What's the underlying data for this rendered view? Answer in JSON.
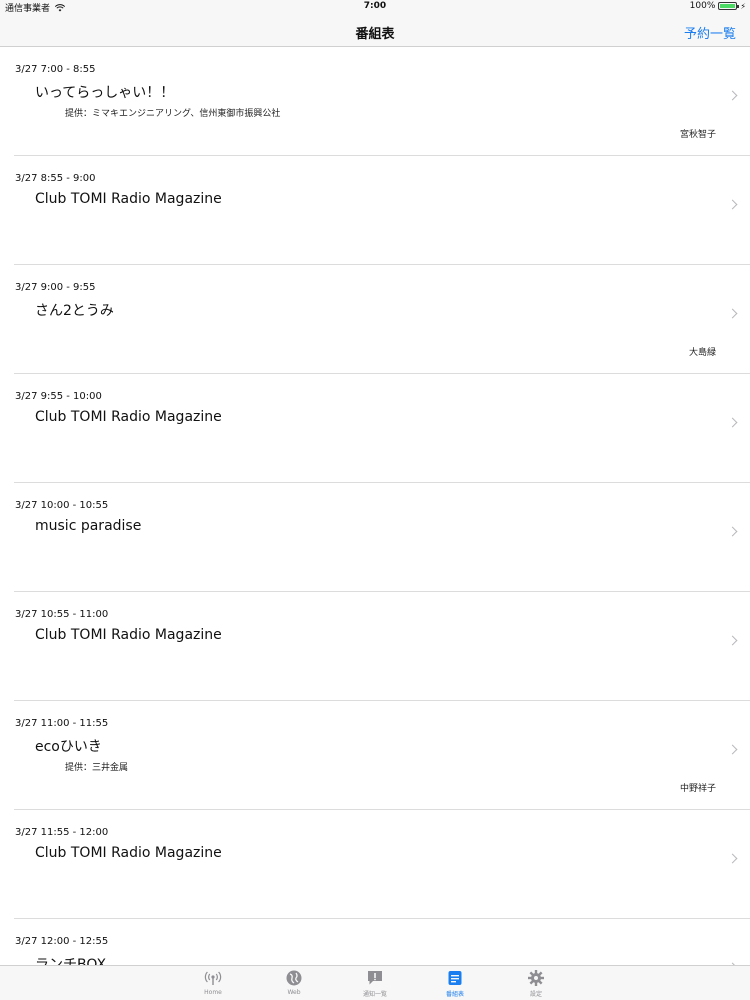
{
  "status_bar": {
    "carrier": "通信事業者",
    "time": "7:00",
    "battery": "100%",
    "battery_level": 1.0
  },
  "nav": {
    "title": "番組表",
    "reserve_label": "予約一覧"
  },
  "programs": [
    {
      "time": "3/27 7:00 - 8:55",
      "title": "いってらっしゃい！！",
      "sponsor": "提供：ミマキエンジニアリング、信州東御市振興公社",
      "host": "宮秋智子"
    },
    {
      "time": "3/27 8:55 - 9:00",
      "title": "Club TOMI Radio Magazine",
      "sponsor": "",
      "host": ""
    },
    {
      "time": "3/27 9:00 - 9:55",
      "title": "さん2とうみ",
      "sponsor": "",
      "host": "大島緑"
    },
    {
      "time": "3/27 9:55 - 10:00",
      "title": "Club TOMI Radio Magazine",
      "sponsor": "",
      "host": ""
    },
    {
      "time": "3/27 10:00 - 10:55",
      "title": "music paradise",
      "sponsor": "",
      "host": ""
    },
    {
      "time": "3/27 10:55 - 11:00",
      "title": "Club TOMI Radio Magazine",
      "sponsor": "",
      "host": ""
    },
    {
      "time": "3/27 11:00 - 11:55",
      "title": "ecoひいき",
      "sponsor": "提供：三井金属",
      "host": "中野祥子"
    },
    {
      "time": "3/27 11:55 - 12:00",
      "title": "Club TOMI Radio Magazine",
      "sponsor": "",
      "host": ""
    },
    {
      "time": "3/27 12:00 - 12:55",
      "title": "ランチBOX",
      "sponsor": "",
      "host": ""
    }
  ],
  "tabs": [
    {
      "label": "Home",
      "icon": "antenna-icon"
    },
    {
      "label": "Web",
      "icon": "globe-icon"
    },
    {
      "label": "通知一覧",
      "icon": "notification-icon"
    },
    {
      "label": "番組表",
      "icon": "schedule-icon"
    },
    {
      "label": "設定",
      "icon": "gear-icon"
    }
  ],
  "active_tab": 3,
  "colors": {
    "accent": "#1a7df0",
    "inactive": "#8e8e93",
    "separator": "#dcdcdc"
  }
}
